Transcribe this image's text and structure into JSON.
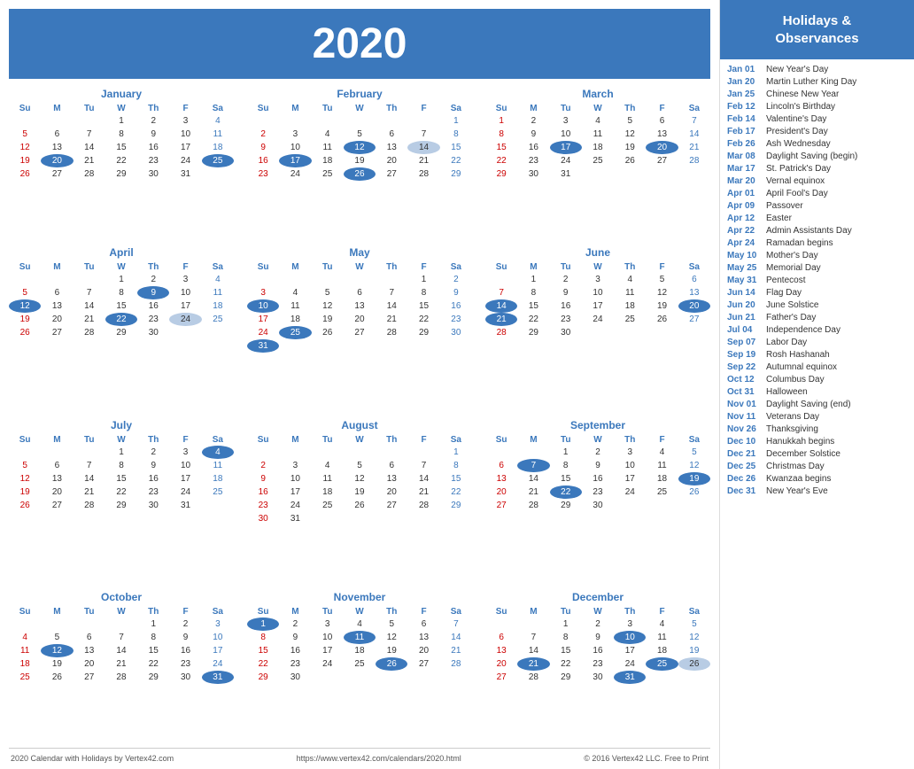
{
  "year": "2020",
  "footer": {
    "left": "2020 Calendar with Holidays by Vertex42.com",
    "center": "https://www.vertex42.com/calendars/2020.html",
    "right": "© 2016 Vertex42 LLC. Free to Print"
  },
  "sidebar_title": "Holidays &\nObservances",
  "holidays": [
    {
      "date": "Jan 01",
      "name": "New Year's Day"
    },
    {
      "date": "Jan 20",
      "name": "Martin Luther King Day"
    },
    {
      "date": "Jan 25",
      "name": "Chinese New Year"
    },
    {
      "date": "Feb 12",
      "name": "Lincoln's Birthday"
    },
    {
      "date": "Feb 14",
      "name": "Valentine's Day"
    },
    {
      "date": "Feb 17",
      "name": "President's Day"
    },
    {
      "date": "Feb 26",
      "name": "Ash Wednesday"
    },
    {
      "date": "Mar 08",
      "name": "Daylight Saving (begin)"
    },
    {
      "date": "Mar 17",
      "name": "St. Patrick's Day"
    },
    {
      "date": "Mar 20",
      "name": "Vernal equinox"
    },
    {
      "date": "Apr 01",
      "name": "April Fool's Day"
    },
    {
      "date": "Apr 09",
      "name": "Passover"
    },
    {
      "date": "Apr 12",
      "name": "Easter"
    },
    {
      "date": "Apr 22",
      "name": "Admin Assistants Day"
    },
    {
      "date": "Apr 24",
      "name": "Ramadan begins"
    },
    {
      "date": "May 10",
      "name": "Mother's Day"
    },
    {
      "date": "May 25",
      "name": "Memorial Day"
    },
    {
      "date": "May 31",
      "name": "Pentecost"
    },
    {
      "date": "Jun 14",
      "name": "Flag Day"
    },
    {
      "date": "Jun 20",
      "name": "June Solstice"
    },
    {
      "date": "Jun 21",
      "name": "Father's Day"
    },
    {
      "date": "Jul 04",
      "name": "Independence Day"
    },
    {
      "date": "Sep 07",
      "name": "Labor Day"
    },
    {
      "date": "Sep 19",
      "name": "Rosh Hashanah"
    },
    {
      "date": "Sep 22",
      "name": "Autumnal equinox"
    },
    {
      "date": "Oct 12",
      "name": "Columbus Day"
    },
    {
      "date": "Oct 31",
      "name": "Halloween"
    },
    {
      "date": "Nov 01",
      "name": "Daylight Saving (end)"
    },
    {
      "date": "Nov 11",
      "name": "Veterans Day"
    },
    {
      "date": "Nov 26",
      "name": "Thanksgiving"
    },
    {
      "date": "Dec 10",
      "name": "Hanukkah begins"
    },
    {
      "date": "Dec 21",
      "name": "December Solstice"
    },
    {
      "date": "Dec 25",
      "name": "Christmas Day"
    },
    {
      "date": "Dec 26",
      "name": "Kwanzaa begins"
    },
    {
      "date": "Dec 31",
      "name": "New Year's Eve"
    }
  ],
  "months": [
    {
      "name": "January",
      "weeks": [
        [
          null,
          null,
          null,
          "1",
          "2",
          "3",
          "4"
        ],
        [
          "5",
          "6",
          "7",
          "8",
          "9",
          "10",
          "11"
        ],
        [
          "12",
          "13",
          "14",
          "15",
          "16",
          "17",
          "18"
        ],
        [
          "19",
          "20h",
          "21",
          "22",
          "23",
          "24",
          "25b"
        ],
        [
          "26",
          "27",
          "28",
          "29",
          "30",
          "31",
          null
        ]
      ]
    },
    {
      "name": "February",
      "weeks": [
        [
          null,
          null,
          null,
          null,
          null,
          null,
          "1"
        ],
        [
          "2",
          "3",
          "4",
          "5",
          "6",
          "7",
          "8"
        ],
        [
          "9",
          "10",
          "11",
          "12h",
          "13",
          "14l",
          "15"
        ],
        [
          "16",
          "17h",
          "18",
          "19",
          "20",
          "21",
          "22"
        ],
        [
          "23",
          "24",
          "25",
          "26h",
          "27",
          "28",
          "29"
        ]
      ]
    },
    {
      "name": "March",
      "weeks": [
        [
          "1",
          "2",
          "3",
          "4",
          "5",
          "6",
          "7"
        ],
        [
          "8",
          "9",
          "10",
          "11",
          "12",
          "13",
          "14"
        ],
        [
          "15",
          "16",
          "17h",
          "18",
          "19",
          "20h",
          "21"
        ],
        [
          "22",
          "23",
          "24",
          "25",
          "26",
          "27",
          "28"
        ],
        [
          "29",
          "30",
          "31",
          null,
          null,
          null,
          null
        ]
      ]
    },
    {
      "name": "April",
      "weeks": [
        [
          null,
          null,
          null,
          "1",
          "2",
          "3",
          "4"
        ],
        [
          "5",
          "6",
          "7",
          "8",
          "9h",
          "10",
          "11"
        ],
        [
          "12h",
          "13",
          "14",
          "15",
          "16",
          "17",
          "18"
        ],
        [
          "19",
          "20",
          "21",
          "22h",
          "23",
          "24l",
          "25"
        ],
        [
          "26",
          "27",
          "28",
          "29",
          "30",
          null,
          null
        ]
      ]
    },
    {
      "name": "May",
      "weeks": [
        [
          null,
          null,
          null,
          null,
          null,
          "1",
          "2"
        ],
        [
          "3",
          "4",
          "5",
          "6",
          "7",
          "8",
          "9"
        ],
        [
          "10h",
          "11",
          "12",
          "13",
          "14",
          "15",
          "16"
        ],
        [
          "17",
          "18",
          "19",
          "20",
          "21",
          "22",
          "23"
        ],
        [
          "24",
          "25b",
          "26",
          "27",
          "28",
          "29",
          "30"
        ],
        [
          "31h",
          null,
          null,
          null,
          null,
          null,
          null
        ]
      ]
    },
    {
      "name": "June",
      "weeks": [
        [
          null,
          "1",
          "2",
          "3",
          "4",
          "5",
          "6"
        ],
        [
          "7",
          "8",
          "9",
          "10",
          "11",
          "12",
          "13"
        ],
        [
          "14h",
          "15",
          "16",
          "17",
          "18",
          "19",
          "20h"
        ],
        [
          "21h",
          "22",
          "23",
          "24",
          "25",
          "26",
          "27"
        ],
        [
          "28",
          "29",
          "30",
          null,
          null,
          null,
          null
        ]
      ]
    },
    {
      "name": "July",
      "weeks": [
        [
          null,
          null,
          null,
          "1",
          "2",
          "3",
          "4b"
        ],
        [
          "5",
          "6",
          "7",
          "8",
          "9",
          "10",
          "11"
        ],
        [
          "12",
          "13",
          "14",
          "15",
          "16",
          "17",
          "18"
        ],
        [
          "19",
          "20",
          "21",
          "22",
          "23",
          "24",
          "25"
        ],
        [
          "26",
          "27",
          "28",
          "29",
          "30",
          "31",
          null
        ]
      ]
    },
    {
      "name": "August",
      "weeks": [
        [
          null,
          null,
          null,
          null,
          null,
          null,
          "1"
        ],
        [
          "2",
          "3",
          "4",
          "5",
          "6",
          "7",
          "8"
        ],
        [
          "9",
          "10",
          "11",
          "12",
          "13",
          "14",
          "15"
        ],
        [
          "16",
          "17",
          "18",
          "19",
          "20",
          "21",
          "22"
        ],
        [
          "23",
          "24",
          "25",
          "26",
          "27",
          "28",
          "29"
        ],
        [
          "30",
          "31",
          null,
          null,
          null,
          null,
          null
        ]
      ]
    },
    {
      "name": "September",
      "weeks": [
        [
          null,
          null,
          "1",
          "2",
          "3",
          "4",
          "5"
        ],
        [
          "6",
          "7b",
          "8",
          "9",
          "10",
          "11",
          "12"
        ],
        [
          "13",
          "14",
          "15",
          "16",
          "17",
          "18",
          "19h"
        ],
        [
          "20",
          "21",
          "22h",
          "23",
          "24",
          "25",
          "26"
        ],
        [
          "27",
          "28",
          "29",
          "30",
          null,
          null,
          null
        ]
      ]
    },
    {
      "name": "October",
      "weeks": [
        [
          null,
          null,
          null,
          null,
          "1",
          "2",
          "3"
        ],
        [
          "4",
          "5",
          "6",
          "7",
          "8",
          "9",
          "10"
        ],
        [
          "11",
          "12h",
          "13",
          "14",
          "15",
          "16",
          "17"
        ],
        [
          "18",
          "19",
          "20",
          "21",
          "22",
          "23",
          "24"
        ],
        [
          "25",
          "26",
          "27",
          "28",
          "29",
          "30",
          "31b"
        ]
      ]
    },
    {
      "name": "November",
      "weeks": [
        [
          "1h",
          "2",
          "3",
          "4",
          "5",
          "6",
          "7"
        ],
        [
          "8",
          "9",
          "10",
          "11b",
          "12",
          "13",
          "14"
        ],
        [
          "15",
          "16",
          "17",
          "18",
          "19",
          "20",
          "21"
        ],
        [
          "22",
          "23",
          "24",
          "25",
          "26b",
          "27",
          "28"
        ],
        [
          "29",
          "30",
          null,
          null,
          null,
          null,
          null
        ]
      ]
    },
    {
      "name": "December",
      "weeks": [
        [
          null,
          null,
          "1",
          "2",
          "3",
          "4",
          "5"
        ],
        [
          "6",
          "7",
          "8",
          "9",
          "10h",
          "11",
          "12"
        ],
        [
          "13",
          "14",
          "15",
          "16",
          "17",
          "18",
          "19"
        ],
        [
          "20",
          "21h",
          "22",
          "23",
          "24",
          "25b",
          "26l"
        ],
        [
          "27",
          "28",
          "29",
          "30",
          "31b",
          null,
          null
        ]
      ]
    }
  ]
}
